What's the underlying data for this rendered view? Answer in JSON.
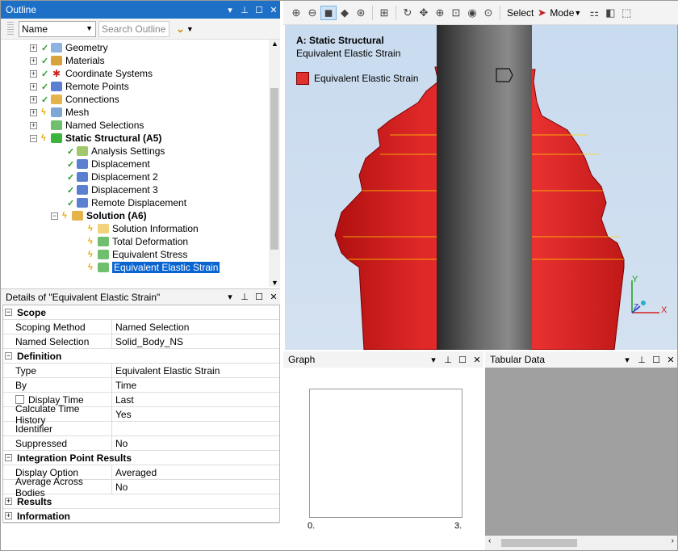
{
  "outline": {
    "title": "Outline",
    "filter_select": "Name",
    "search_placeholder": "Search Outline",
    "items": [
      {
        "label": "Geometry"
      },
      {
        "label": "Materials"
      },
      {
        "label": "Coordinate Systems"
      },
      {
        "label": "Remote Points"
      },
      {
        "label": "Connections"
      },
      {
        "label": "Mesh"
      },
      {
        "label": "Named Selections"
      },
      {
        "label": "Static Structural (A5)"
      },
      {
        "label": "Analysis Settings"
      },
      {
        "label": "Displacement"
      },
      {
        "label": "Displacement 2"
      },
      {
        "label": "Displacement 3"
      },
      {
        "label": "Remote Displacement"
      },
      {
        "label": "Solution (A6)"
      },
      {
        "label": "Solution Information"
      },
      {
        "label": "Total Deformation"
      },
      {
        "label": "Equivalent Stress"
      },
      {
        "label": "Equivalent Elastic Strain"
      }
    ]
  },
  "details": {
    "title": "Details of \"Equivalent Elastic Strain\"",
    "groups": {
      "scope": "Scope",
      "definition": "Definition",
      "integration": "Integration Point Results",
      "results": "Results",
      "information": "Information"
    },
    "rows": {
      "scoping_method": {
        "k": "Scoping Method",
        "v": "Named Selection"
      },
      "named_selection": {
        "k": "Named Selection",
        "v": "Solid_Body_NS"
      },
      "type": {
        "k": "Type",
        "v": "Equivalent Elastic Strain"
      },
      "by": {
        "k": "By",
        "v": "Time"
      },
      "display_time": {
        "k": "Display Time",
        "v": "Last"
      },
      "calc_time_history": {
        "k": "Calculate Time History",
        "v": "Yes"
      },
      "identifier": {
        "k": "Identifier",
        "v": ""
      },
      "suppressed": {
        "k": "Suppressed",
        "v": "No"
      },
      "display_option": {
        "k": "Display Option",
        "v": "Averaged"
      },
      "avg_across_bodies": {
        "k": "Average Across Bodies",
        "v": "No"
      }
    }
  },
  "toolbar": {
    "select_label": "Select",
    "mode_label": "Mode"
  },
  "viewport": {
    "title": "A: Static Structural",
    "subtitle": "Equivalent Elastic Strain",
    "legend_label": "Equivalent Elastic Strain",
    "legend_color": "#e03030",
    "axis_x": "X",
    "axis_y": "Y",
    "axis_z": "Z"
  },
  "graph": {
    "title": "Graph",
    "x_min": "0.",
    "x_max": "3."
  },
  "tabular": {
    "title": "Tabular Data"
  },
  "colors": {
    "accent": "#1e6fc6",
    "selection": "#0a64d0",
    "part": "#e03030"
  }
}
